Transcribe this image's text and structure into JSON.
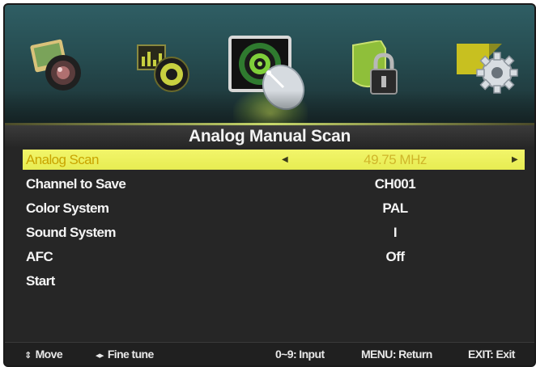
{
  "menu_icons": [
    {
      "name": "picture-menu-icon",
      "active": false
    },
    {
      "name": "sound-menu-icon",
      "active": false
    },
    {
      "name": "channel-menu-icon",
      "active": true
    },
    {
      "name": "lock-menu-icon",
      "active": false
    },
    {
      "name": "setup-menu-icon",
      "active": false
    }
  ],
  "title": "Analog Manual Scan",
  "rows": [
    {
      "label": "Analog Scan",
      "value": "49.75 MHz",
      "selected": true
    },
    {
      "label": "Channel to Save",
      "value": "CH001"
    },
    {
      "label": "Color System",
      "value": "PAL"
    },
    {
      "label": "Sound System",
      "value": "I"
    },
    {
      "label": "AFC",
      "value": "Off"
    },
    {
      "label": "Start",
      "value": ""
    }
  ],
  "footer": {
    "move_glyph": "⇕",
    "move": "Move",
    "fine_glyph": "◂▸",
    "fine_tune": "Fine tune",
    "input": "0~9: Input",
    "menu": "MENU: Return",
    "exit": "EXIT: Exit"
  },
  "colors": {
    "highlight": "#eef060",
    "top_band": "#2f5e64",
    "background": "#262626"
  }
}
